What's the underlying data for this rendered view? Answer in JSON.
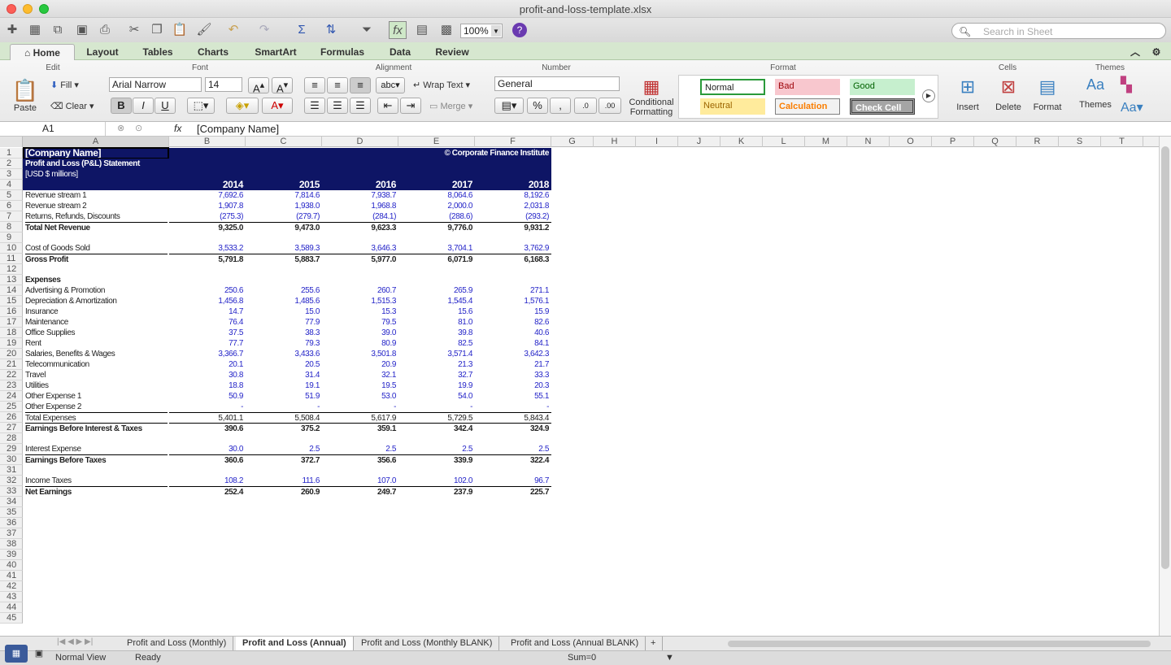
{
  "window": {
    "title": "profit-and-loss-template.xlsx"
  },
  "toolbar": {
    "zoom": "100%",
    "search_placeholder": "Search in Sheet"
  },
  "ribbon_tabs": [
    "Home",
    "Layout",
    "Tables",
    "Charts",
    "SmartArt",
    "Formulas",
    "Data",
    "Review"
  ],
  "ribbon": {
    "groups": {
      "edit": "Edit",
      "font": "Font",
      "alignment": "Alignment",
      "number": "Number",
      "format": "Format",
      "cells": "Cells",
      "themes": "Themes"
    },
    "paste": "Paste",
    "fill": "Fill",
    "clear": "Clear",
    "font_name": "Arial Narrow",
    "font_size": "14",
    "wrap_text": "Wrap Text",
    "merge": "Merge",
    "number_format": "General",
    "conditional_formatting_1": "Conditional",
    "conditional_formatting_2": "Formatting",
    "styles": {
      "normal": "Normal",
      "bad": "Bad",
      "good": "Good",
      "neutral": "Neutral",
      "calculation": "Calculation",
      "check_cell": "Check Cell"
    },
    "insert": "Insert",
    "delete": "Delete",
    "format": "Format",
    "themes": "Themes"
  },
  "formula_bar": {
    "cell_ref": "A1",
    "content": "[Company Name]",
    "fx": "fx"
  },
  "columns": [
    "A",
    "B",
    "C",
    "D",
    "E",
    "F",
    "G",
    "H",
    "I",
    "J",
    "K",
    "L",
    "M",
    "N",
    "O",
    "P",
    "Q",
    "R",
    "S",
    "T"
  ],
  "sheet": {
    "company": "[Company Name]",
    "statement": "Profit and Loss (P&L) Statement",
    "units": "[USD $ millions]",
    "credit": "© Corporate Finance Institute",
    "years": [
      "2014",
      "2015",
      "2016",
      "2017",
      "2018"
    ],
    "rows": [
      {
        "r": "5",
        "label": "Revenue stream 1",
        "v": [
          "7,692.6",
          "7,814.6",
          "7,938.7",
          "8,064.6",
          "8,192.6"
        ],
        "blue": true
      },
      {
        "r": "6",
        "label": "Revenue stream 2",
        "v": [
          "1,907.8",
          "1,938.0",
          "1,968.8",
          "2,000.0",
          "2,031.8"
        ],
        "blue": true
      },
      {
        "r": "7",
        "label": "Returns, Refunds, Discounts",
        "v": [
          "(275.3)",
          "(279.7)",
          "(284.1)",
          "(288.6)",
          "(293.2)"
        ],
        "blue": true
      },
      {
        "r": "8",
        "label": "Total Net Revenue",
        "v": [
          "9,325.0",
          "9,473.0",
          "9,623.3",
          "9,776.0",
          "9,931.2"
        ],
        "bold": true,
        "line": true
      },
      {
        "r": "9",
        "label": "",
        "v": [
          "",
          "",
          "",
          "",
          ""
        ]
      },
      {
        "r": "10",
        "label": "Cost of Goods Sold",
        "v": [
          "3,533.2",
          "3,589.3",
          "3,646.3",
          "3,704.1",
          "3,762.9"
        ],
        "blue": true
      },
      {
        "r": "11",
        "label": "Gross Profit",
        "v": [
          "5,791.8",
          "5,883.7",
          "5,977.0",
          "6,071.9",
          "6,168.3"
        ],
        "bold": true,
        "line": true
      },
      {
        "r": "12",
        "label": "",
        "v": [
          "",
          "",
          "",
          "",
          ""
        ]
      },
      {
        "r": "13",
        "label": "Expenses",
        "v": [
          "",
          "",
          "",
          "",
          ""
        ],
        "bold": true
      },
      {
        "r": "14",
        "label": "Advertising & Promotion",
        "v": [
          "250.6",
          "255.6",
          "260.7",
          "265.9",
          "271.1"
        ],
        "blue": true
      },
      {
        "r": "15",
        "label": "Depreciation & Amortization",
        "v": [
          "1,456.8",
          "1,485.6",
          "1,515.3",
          "1,545.4",
          "1,576.1"
        ],
        "blue": true
      },
      {
        "r": "16",
        "label": "Insurance",
        "v": [
          "14.7",
          "15.0",
          "15.3",
          "15.6",
          "15.9"
        ],
        "blue": true
      },
      {
        "r": "17",
        "label": "Maintenance",
        "v": [
          "76.4",
          "77.9",
          "79.5",
          "81.0",
          "82.6"
        ],
        "blue": true
      },
      {
        "r": "18",
        "label": "Office Supplies",
        "v": [
          "37.5",
          "38.3",
          "39.0",
          "39.8",
          "40.6"
        ],
        "blue": true
      },
      {
        "r": "19",
        "label": "Rent",
        "v": [
          "77.7",
          "79.3",
          "80.9",
          "82.5",
          "84.1"
        ],
        "blue": true
      },
      {
        "r": "20",
        "label": "Salaries, Benefits & Wages",
        "v": [
          "3,366.7",
          "3,433.6",
          "3,501.8",
          "3,571.4",
          "3,642.3"
        ],
        "blue": true
      },
      {
        "r": "21",
        "label": "Telecommunication",
        "v": [
          "20.1",
          "20.5",
          "20.9",
          "21.3",
          "21.7"
        ],
        "blue": true
      },
      {
        "r": "22",
        "label": "Travel",
        "v": [
          "30.8",
          "31.4",
          "32.1",
          "32.7",
          "33.3"
        ],
        "blue": true
      },
      {
        "r": "23",
        "label": "Utilities",
        "v": [
          "18.8",
          "19.1",
          "19.5",
          "19.9",
          "20.3"
        ],
        "blue": true
      },
      {
        "r": "24",
        "label": "Other Expense 1",
        "v": [
          "50.9",
          "51.9",
          "53.0",
          "54.0",
          "55.1"
        ],
        "blue": true
      },
      {
        "r": "25",
        "label": "Other Expense 2",
        "v": [
          "-",
          "-",
          "-",
          "-",
          "-"
        ],
        "blue": true
      },
      {
        "r": "26",
        "label": "Total Expenses",
        "v": [
          "5,401.1",
          "5,508.4",
          "5,617.9",
          "5,729.5",
          "5,843.4"
        ],
        "line": true
      },
      {
        "r": "27",
        "label": "Earnings Before Interest & Taxes",
        "v": [
          "390.6",
          "375.2",
          "359.1",
          "342.4",
          "324.9"
        ],
        "bold": true,
        "line": true
      },
      {
        "r": "28",
        "label": "",
        "v": [
          "",
          "",
          "",
          "",
          ""
        ]
      },
      {
        "r": "29",
        "label": "Interest Expense",
        "v": [
          "30.0",
          "2.5",
          "2.5",
          "2.5",
          "2.5"
        ],
        "blue": true
      },
      {
        "r": "30",
        "label": "Earnings Before Taxes",
        "v": [
          "360.6",
          "372.7",
          "356.6",
          "339.9",
          "322.4"
        ],
        "bold": true,
        "line": true
      },
      {
        "r": "31",
        "label": "",
        "v": [
          "",
          "",
          "",
          "",
          ""
        ]
      },
      {
        "r": "32",
        "label": "Income Taxes",
        "v": [
          "108.2",
          "111.6",
          "107.0",
          "102.0",
          "96.7"
        ],
        "blue": true
      },
      {
        "r": "33",
        "label": "Net Earnings",
        "v": [
          "252.4",
          "260.9",
          "249.7",
          "237.9",
          "225.7"
        ],
        "bold": true,
        "line": true
      }
    ],
    "empty_rows": [
      "34",
      "35",
      "36",
      "37",
      "38",
      "39",
      "40",
      "41",
      "42",
      "43",
      "44",
      "45"
    ]
  },
  "sheet_tabs": [
    "Profit and Loss (Monthly)",
    "Profit and Loss (Annual)",
    "Profit and Loss (Monthly BLANK)",
    "Profit and Loss (Annual BLANK)"
  ],
  "active_sheet": 1,
  "status": {
    "view": "Normal View",
    "state": "Ready",
    "sum": "Sum=0"
  }
}
